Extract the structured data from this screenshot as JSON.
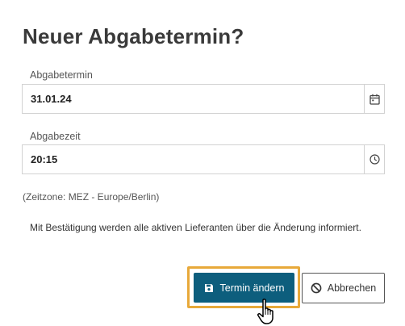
{
  "dialog": {
    "title": "Neuer Abgabetermin?",
    "date_field": {
      "label": "Abgabetermin",
      "value": "31.01.24",
      "icon": "calendar-icon"
    },
    "time_field": {
      "label": "Abgabezeit",
      "value": "20:15",
      "icon": "clock-icon"
    },
    "timezone_note": "(Zeitzone: MEZ - Europe/Berlin)",
    "info_text": "Mit Bestätigung werden alle aktiven Lieferanten über die Änderung informiert.",
    "confirm_button": {
      "label": "Termin ändern",
      "icon": "save-icon",
      "color": "#0d5e7d"
    },
    "cancel_button": {
      "label": "Abbrechen",
      "icon": "cancel-icon"
    },
    "highlight_color": "#e8a93a"
  }
}
